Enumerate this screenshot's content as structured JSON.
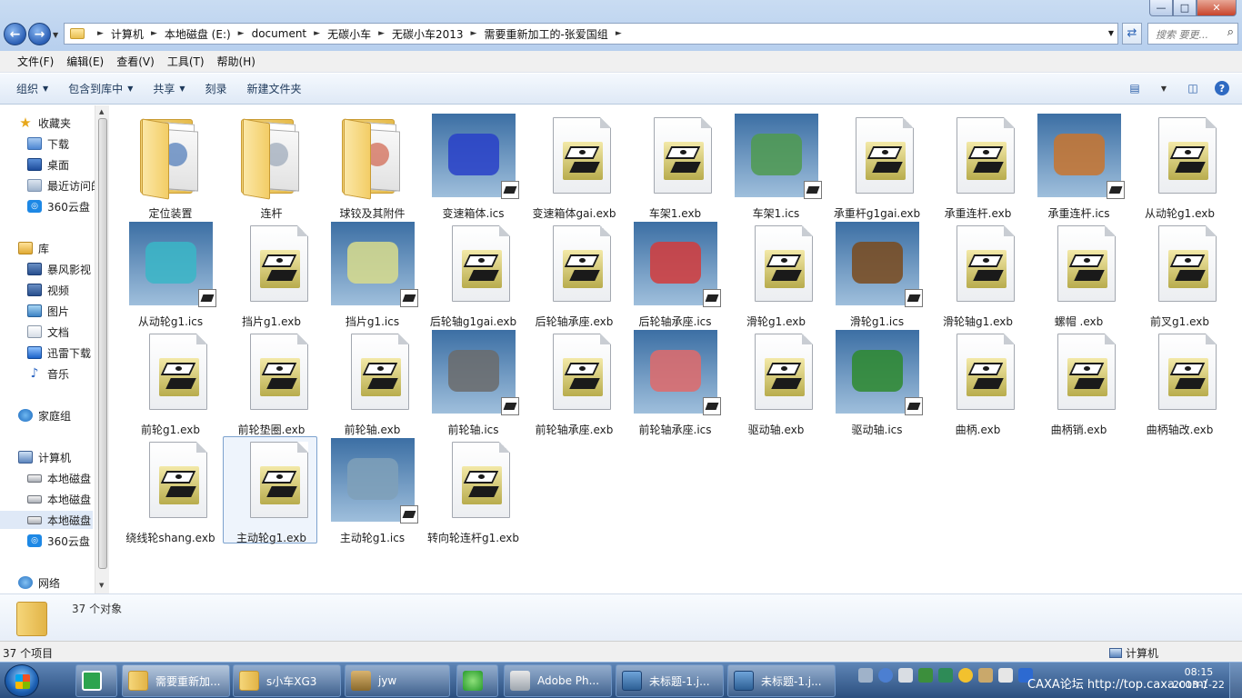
{
  "window": {
    "controls": [
      "—",
      "□",
      "✕"
    ]
  },
  "address": {
    "crumbs": [
      "计算机",
      "本地磁盘 (E:)",
      "document",
      "无碳小车",
      "无碳小车2013",
      "需要重新加工的-张爱国组"
    ],
    "search_placeholder": "搜索 要更..."
  },
  "menu": [
    "文件(F)",
    "编辑(E)",
    "查看(V)",
    "工具(T)",
    "帮助(H)"
  ],
  "toolbar": {
    "organize": "组织",
    "include_in_library": "包含到库中",
    "share": "共享",
    "burn": "刻录",
    "new_folder": "新建文件夹"
  },
  "nav": {
    "favorites": "收藏夹",
    "downloads": "下载",
    "desktop": "桌面",
    "recent": "最近访问的",
    "cloud360_a": "360云盘",
    "library": "库",
    "baofeng": "暴风影视",
    "videos": "视频",
    "pictures": "图片",
    "documents": "文档",
    "xunlei": "迅雷下载",
    "music": "音乐",
    "homegroup": "家庭组",
    "computer": "计算机",
    "disk1": "本地磁盘",
    "disk2": "本地磁盘",
    "disk3": "本地磁盘",
    "cloud360_b": "360云盘",
    "network": "网络"
  },
  "files": [
    {
      "name": "定位装置",
      "kind": "folder",
      "accent": "#4a78b8"
    },
    {
      "name": "连杆",
      "kind": "folder",
      "accent": "#9aa7b8"
    },
    {
      "name": "球铰及其附件",
      "kind": "folder",
      "accent": "#d0634c"
    },
    {
      "name": "变速箱体.ics",
      "kind": "ics",
      "accent": "#2840c8"
    },
    {
      "name": "变速箱体gai.exb",
      "kind": "exb"
    },
    {
      "name": "车架1.exb",
      "kind": "exb"
    },
    {
      "name": "车架1.ics",
      "kind": "ics",
      "accent": "#4f9a4f"
    },
    {
      "name": "承重杆g1gai.exb",
      "kind": "exb"
    },
    {
      "name": "承重连杆.exb",
      "kind": "exb"
    },
    {
      "name": "承重连杆.ics",
      "kind": "ics",
      "accent": "#c8742e"
    },
    {
      "name": "从动轮g1.exb",
      "kind": "exb"
    },
    {
      "name": "从动轮g1.ics",
      "kind": "ics",
      "accent": "#39b6c7"
    },
    {
      "name": "挡片g1.exb",
      "kind": "exb"
    },
    {
      "name": "挡片g1.ics",
      "kind": "ics",
      "accent": "#d8dc8c"
    },
    {
      "name": "后轮轴g1gai.exb",
      "kind": "exb"
    },
    {
      "name": "后轮轴承座.exb",
      "kind": "exb"
    },
    {
      "name": "后轮轴承座.ics",
      "kind": "ics",
      "accent": "#d33b3b"
    },
    {
      "name": "滑轮g1.exb",
      "kind": "exb"
    },
    {
      "name": "滑轮g1.ics",
      "kind": "ics",
      "accent": "#7a4a1c"
    },
    {
      "name": "滑轮轴g1.exb",
      "kind": "exb"
    },
    {
      "name": "螺帽 .exb",
      "kind": "exb"
    },
    {
      "name": "前叉g1.exb",
      "kind": "exb"
    },
    {
      "name": "前轮g1.exb",
      "kind": "exb"
    },
    {
      "name": "前轮垫圈.exb",
      "kind": "exb"
    },
    {
      "name": "前轮轴.exb",
      "kind": "exb"
    },
    {
      "name": "前轮轴.ics",
      "kind": "ics",
      "accent": "#6b6b6b"
    },
    {
      "name": "前轮轴承座.exb",
      "kind": "exb"
    },
    {
      "name": "前轮轴承座.ics",
      "kind": "ics",
      "accent": "#e06a6a"
    },
    {
      "name": "驱动轴.exb",
      "kind": "exb"
    },
    {
      "name": "驱动轴.ics",
      "kind": "ics",
      "accent": "#2e8a2e"
    },
    {
      "name": "曲柄.exb",
      "kind": "exb"
    },
    {
      "name": "曲柄销.exb",
      "kind": "exb"
    },
    {
      "name": "曲柄轴改.exb",
      "kind": "exb"
    },
    {
      "name": "绕线轮shang.exb",
      "kind": "exb"
    },
    {
      "name": "主动轮g1.exb",
      "kind": "exb",
      "selected": true
    },
    {
      "name": "主动轮g1.ics",
      "kind": "ics",
      "accent": "#7fa0b8"
    },
    {
      "name": "转向轮连杆g1.exb",
      "kind": "exb"
    }
  ],
  "details": {
    "count": "37 个对象"
  },
  "status": {
    "items": "37 个项目",
    "location": "计算机"
  },
  "taskbar": {
    "tasks": [
      "需要重新加...",
      "s小车XG3",
      "jyw",
      "Adobe Ph...",
      "未标题-1.j...",
      "未标题-1.j..."
    ],
    "tray_text": "CAXA论坛 http://top.caxa.com/",
    "time": "08:15",
    "date": "2013-1-22"
  }
}
